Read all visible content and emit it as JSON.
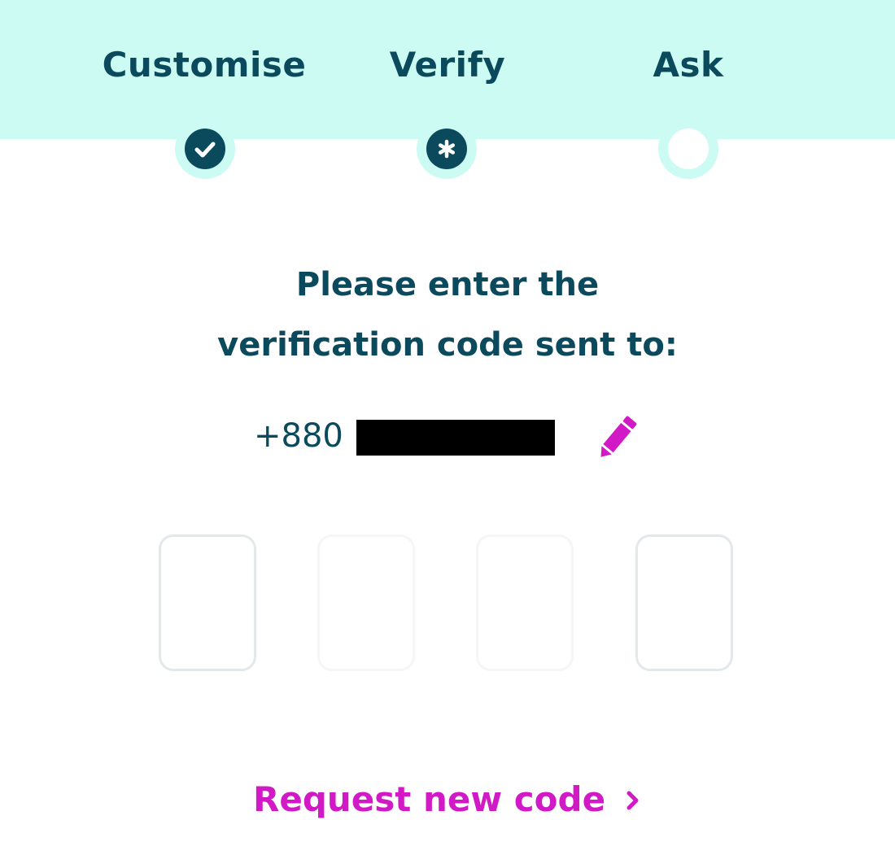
{
  "stepper": {
    "steps": [
      {
        "label": "Customise",
        "state": "complete",
        "icon": "check-icon"
      },
      {
        "label": "Verify",
        "state": "current",
        "icon": "asterisk-icon"
      },
      {
        "label": "Ask",
        "state": "pending",
        "icon": "empty-circle"
      }
    ]
  },
  "verification": {
    "headline_line1": "Please enter the",
    "headline_line2": "verification code sent to:",
    "phone_prefix": "+880 1",
    "phone_masked": true,
    "edit_icon": "pencil-icon",
    "code_digits": [
      "",
      "",
      "",
      ""
    ]
  },
  "request_new_code": {
    "label": "Request new code",
    "icon": "chevron-right-icon"
  },
  "colors": {
    "header_background": "#ccfbf4",
    "primary_text": "#0b4a5c",
    "accent": "#d11ac5"
  }
}
